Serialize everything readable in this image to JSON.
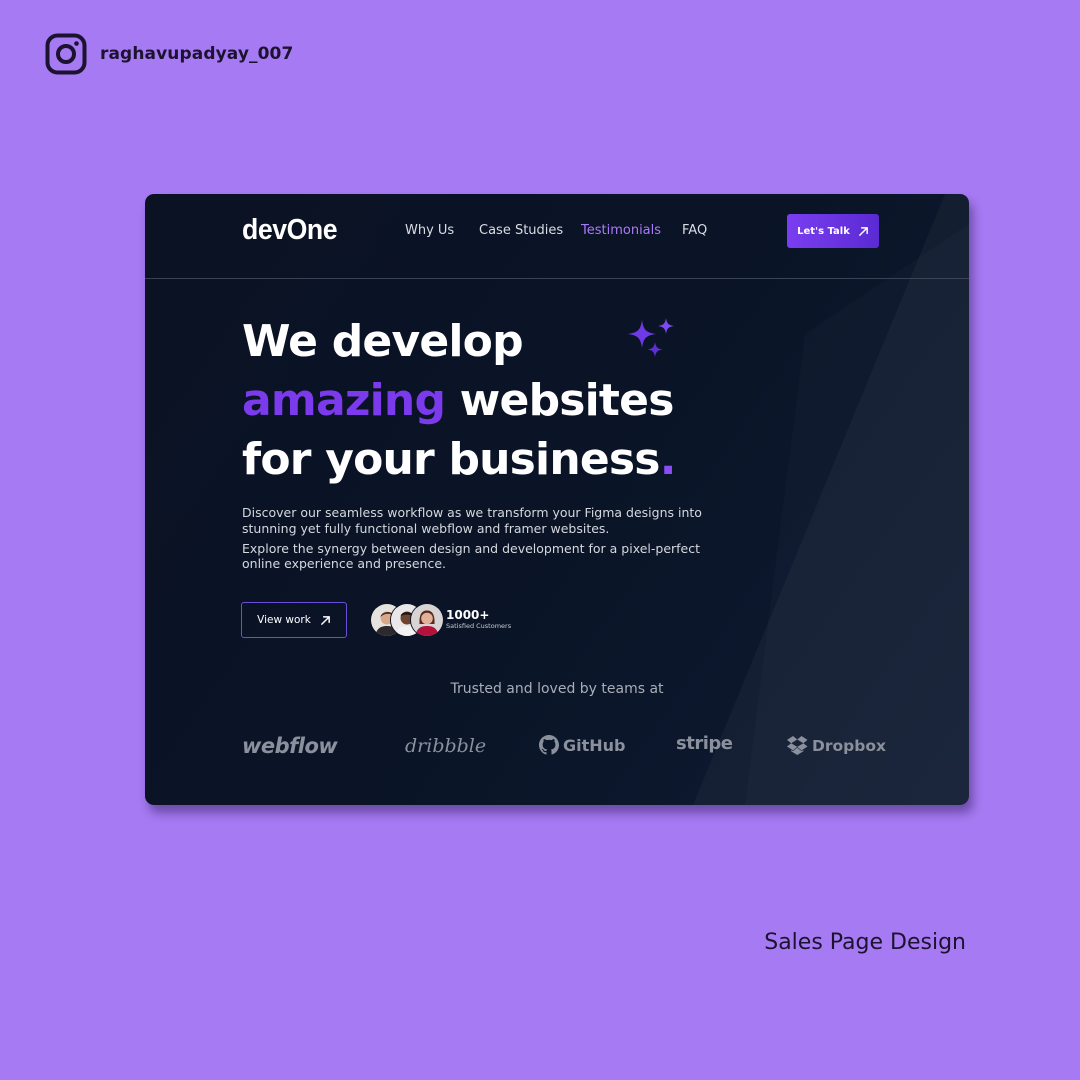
{
  "instagram": {
    "handle": "raghavupadyay_007"
  },
  "caption": "Sales Page Design",
  "site": {
    "logo": "devOne",
    "nav": [
      "Why Us",
      "Case Studies",
      "Testimonials",
      "FAQ"
    ],
    "active_nav": "Testimonials",
    "cta_label": "Let's Talk",
    "hero": {
      "line1": "We develop",
      "line2_accent": "amazing",
      "line2_rest": " websites",
      "line3": "for your business",
      "line3_end": "."
    },
    "description": [
      "Discover our seamless workflow as we transform your Figma designs into stunning yet fully functional webflow and framer websites.",
      "Explore  the synergy between design and development for a pixel-perfect online experience and presence."
    ],
    "view_work_label": "View work",
    "customers": {
      "count": "1000+",
      "label": "Satisfied Customers"
    },
    "trusted_heading": "Trusted and loved by teams at",
    "brands": [
      "webflow",
      "dribbble",
      "GitHub",
      "stripe",
      "Dropbox"
    ]
  },
  "colors": {
    "page_bg": "#a67af3",
    "card_bg": "#0b1224",
    "accent": "#7c3aed",
    "active_link": "#a97af8"
  },
  "icons": {
    "instagram": "instagram-icon",
    "arrow": "arrow-up-right-icon",
    "sparkle": "sparkle-icon",
    "github": "github-icon",
    "dropbox": "dropbox-icon"
  }
}
